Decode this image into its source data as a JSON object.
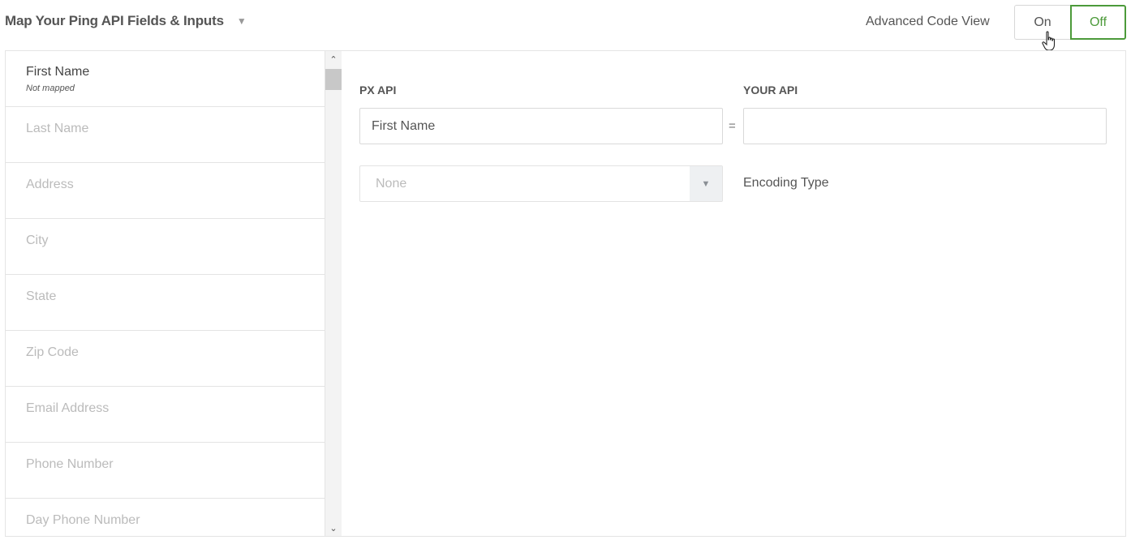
{
  "header": {
    "title": "Map Your Ping API Fields & Inputs",
    "title_caret": "▼",
    "advanced_label": "Advanced Code View",
    "toggle": {
      "on_label": "On",
      "off_label": "Off",
      "selected": "Off"
    }
  },
  "fields": [
    {
      "name": "First Name",
      "status": "Not mapped",
      "active": true
    },
    {
      "name": "Last Name"
    },
    {
      "name": "Address"
    },
    {
      "name": "City"
    },
    {
      "name": "State"
    },
    {
      "name": "Zip Code"
    },
    {
      "name": "Email Address"
    },
    {
      "name": "Phone Number"
    },
    {
      "name": "Day Phone Number"
    }
  ],
  "scroll": {
    "up": "⌃",
    "down": "⌄"
  },
  "mapping": {
    "px_label": "PX API",
    "your_label": "YOUR API",
    "px_value": "First Name",
    "your_value": "",
    "equals": "=",
    "encoding_value": "None",
    "encoding_arrow": "▼",
    "encoding_label": "Encoding Type"
  },
  "colors": {
    "accent": "#4c9a3a"
  }
}
